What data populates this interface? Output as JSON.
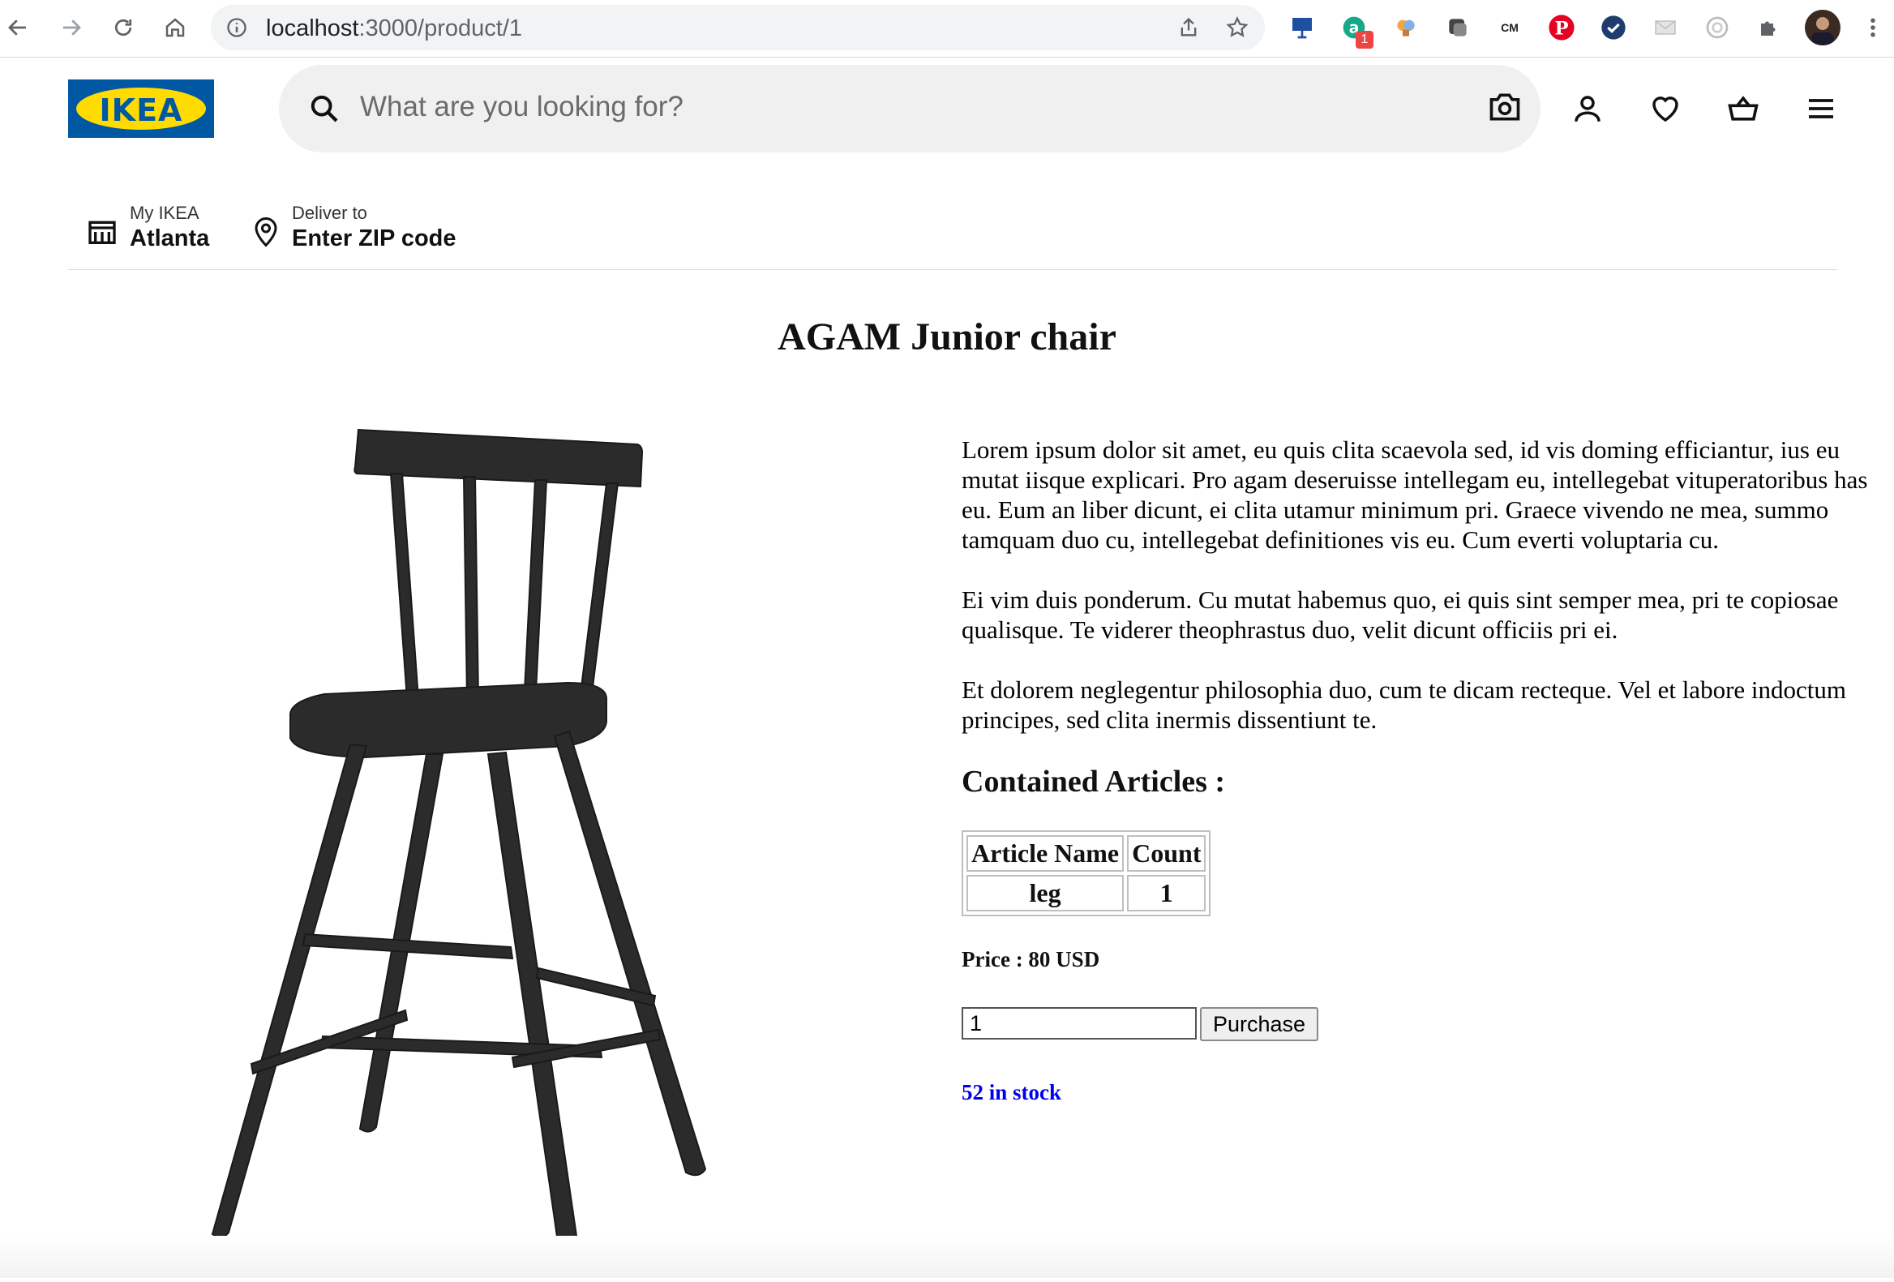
{
  "browser": {
    "url_host": "localhost",
    "url_path": ":3000/product/1",
    "extension_badge": "1",
    "extension_cm_label": "CM",
    "colors": {
      "toolbar_bg": "#ffffff",
      "omnibox_bg": "#f1f3f4"
    }
  },
  "header": {
    "logo_text": "IKEA",
    "search_placeholder": "What are you looking for?",
    "colors": {
      "logo_blue": "#0058a3",
      "logo_yellow": "#ffdb00"
    }
  },
  "location": {
    "store_label": "My IKEA",
    "store_value": "Atlanta",
    "deliver_label": "Deliver to",
    "deliver_value": "Enter ZIP code"
  },
  "product": {
    "title": "AGAM Junior chair",
    "description": [
      "Lorem ipsum dolor sit amet, eu quis clita scaevola sed, id vis doming efficiantur, ius eu mutat iisque explicari. Pro agam deseruisse intellegam eu, intellegebat vituperatoribus has eu. Eum an liber dicunt, ei clita utamur minimum pri. Graece vivendo ne mea, summo tamquam duo cu, intellegebat definitiones vis eu. Cum everti voluptaria cu.",
      "Ei vim duis ponderum. Cu mutat habemus quo, ei quis sint semper mea, pri te copiosae qualisque. Te viderer theophrastus duo, velit dicunt officiis pri ei.",
      "Et dolorem neglegentur philosophia duo, cum te dicam recteque. Vel et labore indoctum principes, sed clita inermis dissentiunt te."
    ],
    "contained_heading": "Contained Articles :",
    "articles_table": {
      "headers": [
        "Article Name",
        "Count"
      ],
      "rows": [
        [
          "leg",
          "1"
        ]
      ]
    },
    "price_text": "Price : 80 USD",
    "quantity_value": "1",
    "purchase_label": "Purchase",
    "stock_text": "52 in stock",
    "colors": {
      "stock": "#0000ee"
    }
  }
}
